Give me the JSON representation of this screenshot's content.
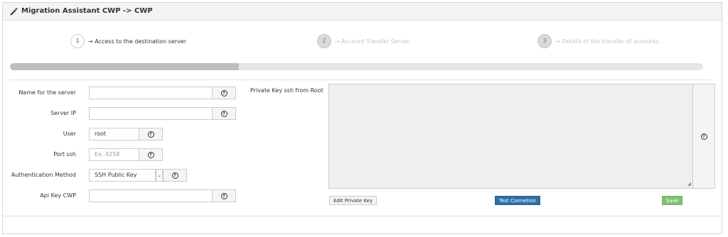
{
  "header": {
    "title": "Migration Assistant CWP -> CWP",
    "icon": "wand-icon"
  },
  "steps": [
    {
      "number": "1",
      "label": "→ Access to the destination server",
      "active": true
    },
    {
      "number": "2",
      "label": "→ Account Transfer Server",
      "active": false
    },
    {
      "number": "3",
      "label": "→ Details of the transfer of accounts",
      "active": false
    }
  ],
  "progress": {
    "percent": 33
  },
  "form": {
    "server_name": {
      "label": "Name for the server",
      "value": ""
    },
    "server_ip": {
      "label": "Server IP",
      "value": ""
    },
    "user": {
      "label": "User",
      "value": "root"
    },
    "port": {
      "label": "Port ssh",
      "placeholder": "Ex: 4258"
    },
    "auth_method": {
      "label": "Authentication Method",
      "selected": "SSH Public Key"
    },
    "api_key": {
      "label": "Api Key CWP",
      "value": ""
    },
    "private_key": {
      "label": "Private Key ssh from Root"
    }
  },
  "buttons": {
    "edit_key": "Edit Private Key",
    "test": "Test Connetion",
    "save": "Save"
  },
  "help_glyph": "?",
  "colors": {
    "primary": "#2f6fa8",
    "success": "#82c16f",
    "progress_fill": "#bdbdbd"
  }
}
